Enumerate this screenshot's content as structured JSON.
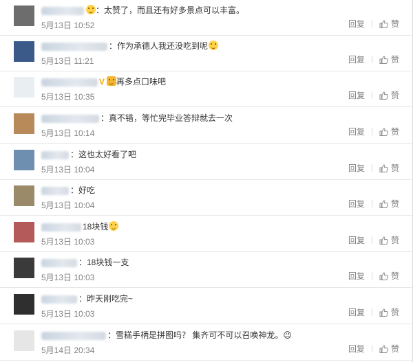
{
  "comments": [
    {
      "content": "：太赞了，而且还有好多景点可以丰富。",
      "time": "5月13日 10:52",
      "reply": "回复",
      "like": "赞",
      "avatar_color": "#6d6d6d",
      "emoji": "before",
      "v": false
    },
    {
      "content": "：作为承德人我还没吃到呢",
      "time": "5月13日 11:21",
      "reply": "回复",
      "like": "赞",
      "avatar_color": "#3b5a8a",
      "emoji": "after",
      "v": false
    },
    {
      "content": "再多点口味吧",
      "time": "5月13日 10:35",
      "reply": "回复",
      "like": "赞",
      "avatar_color": "#e9eef3",
      "emoji": "cat",
      "v": true
    },
    {
      "content": "：真不错，等忙完毕业答辩就去一次",
      "time": "5月13日 10:14",
      "reply": "回复",
      "like": "赞",
      "avatar_color": "#b88a5a",
      "emoji": "",
      "v": false
    },
    {
      "content": "：这也太好看了吧",
      "time": "5月13日 10:04",
      "reply": "回复",
      "like": "赞",
      "avatar_color": "#6f8fb0",
      "emoji": "",
      "v": false
    },
    {
      "content": "：好吃",
      "time": "5月13日 10:04",
      "reply": "回复",
      "like": "赞",
      "avatar_color": "#9a8a6a",
      "emoji": "",
      "v": false
    },
    {
      "content": "18块钱",
      "time": "5月13日 10:03",
      "reply": "回复",
      "like": "赞",
      "avatar_color": "#b55a5a",
      "emoji": "after",
      "v": false
    },
    {
      "content": "：18块钱一支",
      "time": "5月13日 10:03",
      "reply": "回复",
      "like": "赞",
      "avatar_color": "#3a3a3a",
      "emoji": "",
      "v": false
    },
    {
      "content": "：昨天刚吃完~",
      "time": "5月13日 10:03",
      "reply": "回复",
      "like": "赞",
      "avatar_color": "#2f2f2f",
      "emoji": "",
      "v": false
    },
    {
      "content": "：雪糕手柄是拼图吗？ 集齐可不可以召唤神龙。😉",
      "time": "5月14日 20:34",
      "reply": "回复",
      "like": "赞",
      "avatar_color": "#e6e6e6",
      "emoji": "",
      "v": false
    }
  ]
}
